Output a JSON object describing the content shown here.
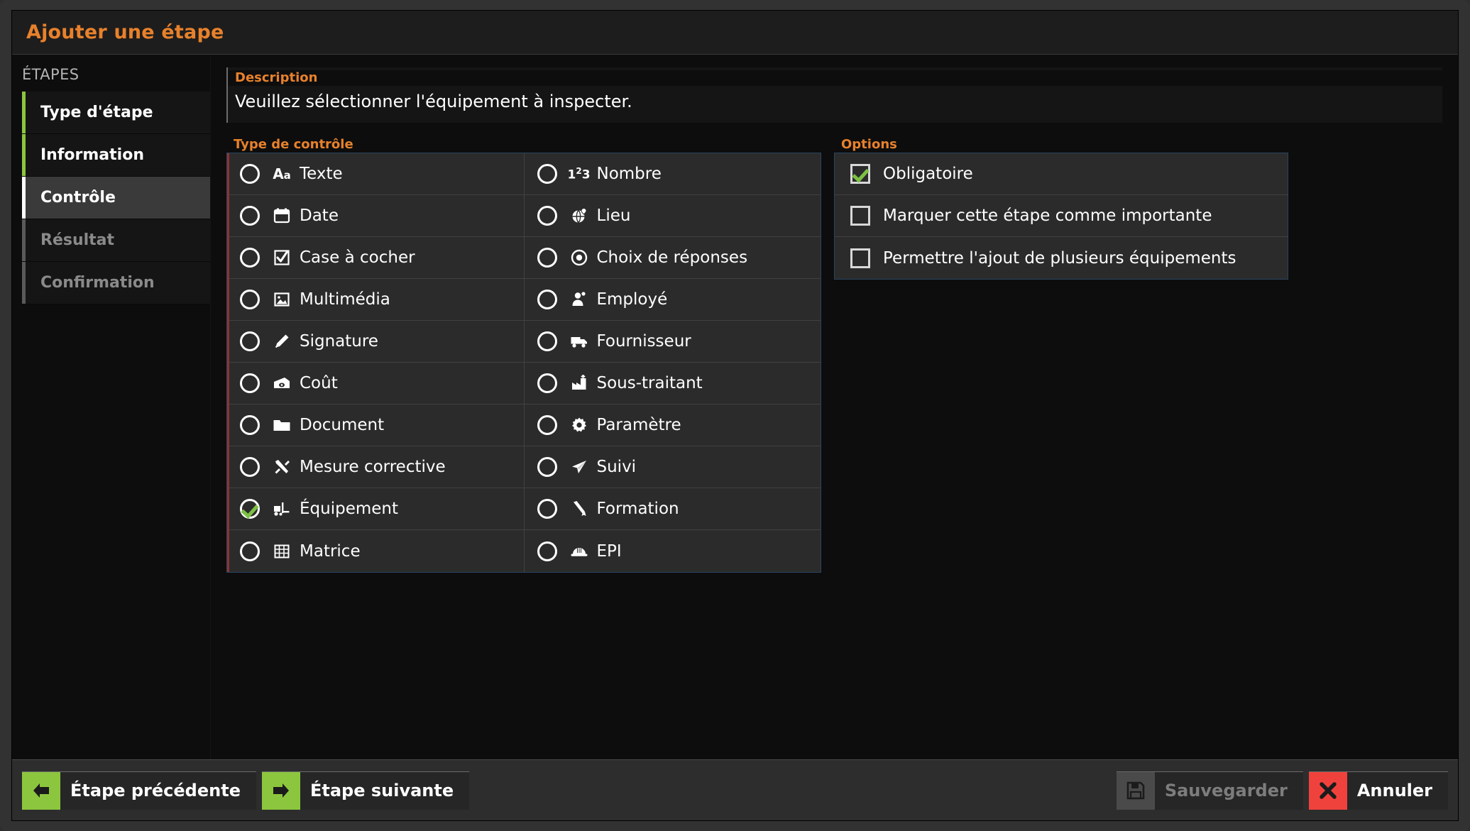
{
  "window": {
    "title": "Ajouter une étape"
  },
  "sidebar": {
    "heading": "ÉTAPES",
    "items": [
      {
        "label": "Type d'étape",
        "state": "done"
      },
      {
        "label": "Information",
        "state": "done"
      },
      {
        "label": "Contrôle",
        "state": "active"
      },
      {
        "label": "Résultat",
        "state": "todo"
      },
      {
        "label": "Confirmation",
        "state": "todo"
      }
    ]
  },
  "description": {
    "legend": "Description",
    "value": "Veuillez sélectionner l'équipement à inspecter."
  },
  "control_type": {
    "legend": "Type de contrôle",
    "required": true,
    "left_column": [
      {
        "label": "Texte",
        "icon": "text-aa-icon",
        "selected": false
      },
      {
        "label": "Date",
        "icon": "calendar-icon",
        "selected": false
      },
      {
        "label": "Case à cocher",
        "icon": "checkbox-icon",
        "selected": false
      },
      {
        "label": "Multimédia",
        "icon": "image-icon",
        "selected": false
      },
      {
        "label": "Signature",
        "icon": "pen-icon",
        "selected": false
      },
      {
        "label": "Coût",
        "icon": "money-icon",
        "selected": false
      },
      {
        "label": "Document",
        "icon": "folder-icon",
        "selected": false
      },
      {
        "label": "Mesure corrective",
        "icon": "tools-icon",
        "selected": false
      },
      {
        "label": "Équipement",
        "icon": "forklift-icon",
        "selected": true
      },
      {
        "label": "Matrice",
        "icon": "grid-icon",
        "selected": false
      }
    ],
    "right_column": [
      {
        "label": "Nombre",
        "icon": "number-123-icon",
        "selected": false
      },
      {
        "label": "Lieu",
        "icon": "globe-pin-icon",
        "selected": false
      },
      {
        "label": "Choix de réponses",
        "icon": "radio-dot-icon",
        "selected": false
      },
      {
        "label": "Employé",
        "icon": "person-icon",
        "selected": false
      },
      {
        "label": "Fournisseur",
        "icon": "truck-icon",
        "selected": false
      },
      {
        "label": "Sous-traitant",
        "icon": "factory-icon",
        "selected": false
      },
      {
        "label": "Paramètre",
        "icon": "gear-icon",
        "selected": false
      },
      {
        "label": "Suivi",
        "icon": "paper-plane-icon",
        "selected": false
      },
      {
        "label": "Formation",
        "icon": "diploma-icon",
        "selected": false
      },
      {
        "label": "EPI",
        "icon": "hardhat-icon",
        "selected": false
      }
    ]
  },
  "options": {
    "legend": "Options",
    "items": [
      {
        "label": "Obligatoire",
        "checked": true
      },
      {
        "label": "Marquer cette étape comme importante",
        "checked": false
      },
      {
        "label": "Permettre l'ajout de plusieurs équipements",
        "checked": false
      }
    ]
  },
  "footer": {
    "previous_label": "Étape précédente",
    "next_label": "Étape suivante",
    "save_label": "Sauvegarder",
    "cancel_label": "Annuler",
    "save_disabled": true
  },
  "colors": {
    "accent_orange": "#e8812b",
    "green": "#8cc63e",
    "red": "#f0423c",
    "check_green": "#7cc143",
    "required_bar": "#8e3232",
    "panel_border": "#2a4560"
  }
}
